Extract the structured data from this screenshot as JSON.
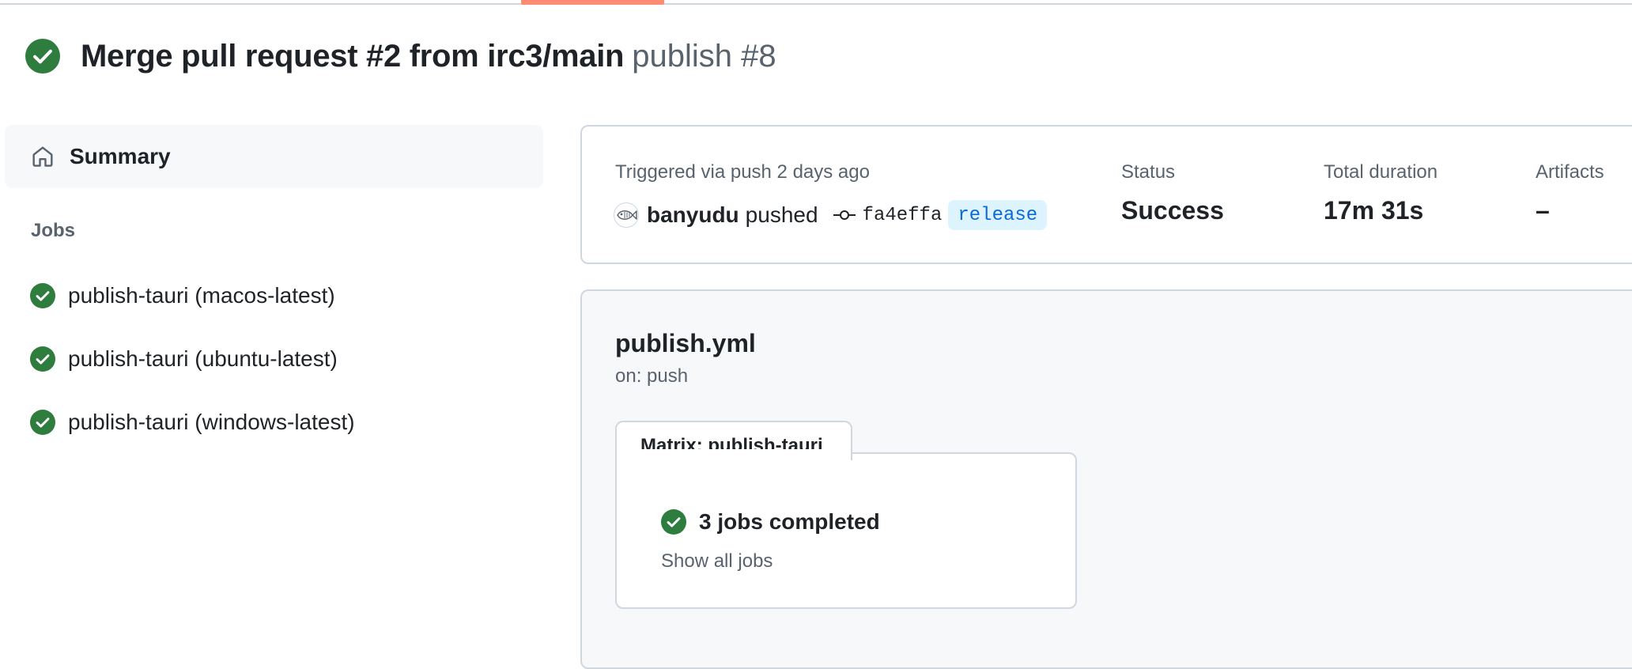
{
  "header": {
    "title": "Merge pull request #2 from irc3/main",
    "subtitle": "publish #8",
    "status_icon": "check-circle-fill-icon",
    "status_color": "#1a7f37"
  },
  "sidebar": {
    "summary_label": "Summary",
    "summary_icon": "home-icon",
    "jobs_heading": "Jobs",
    "jobs": [
      {
        "label": "publish-tauri (macos-latest)",
        "status": "success"
      },
      {
        "label": "publish-tauri (ubuntu-latest)",
        "status": "success"
      },
      {
        "label": "publish-tauri (windows-latest)",
        "status": "success"
      }
    ]
  },
  "summary": {
    "trigger_text": "Triggered via push 2 days ago",
    "pusher": "banyudu",
    "pushed_word": "pushed",
    "commit_sha": "fa4effa",
    "branch": "release",
    "status_label": "Status",
    "status_value": "Success",
    "duration_label": "Total duration",
    "duration_value": "17m 31s",
    "artifacts_label": "Artifacts",
    "artifacts_value": "–"
  },
  "workflow": {
    "file": "publish.yml",
    "trigger": "on: push",
    "matrix_label": "Matrix: publish-tauri",
    "jobs_completed": "3 jobs completed",
    "show_all_jobs": "Show all jobs"
  },
  "colors": {
    "success": "#1a7f37",
    "accent_underline": "#fd8c73",
    "branch_bg": "#ddf4ff",
    "branch_fg": "#0969da",
    "muted_text": "#59636e",
    "border": "#d0d7de"
  }
}
